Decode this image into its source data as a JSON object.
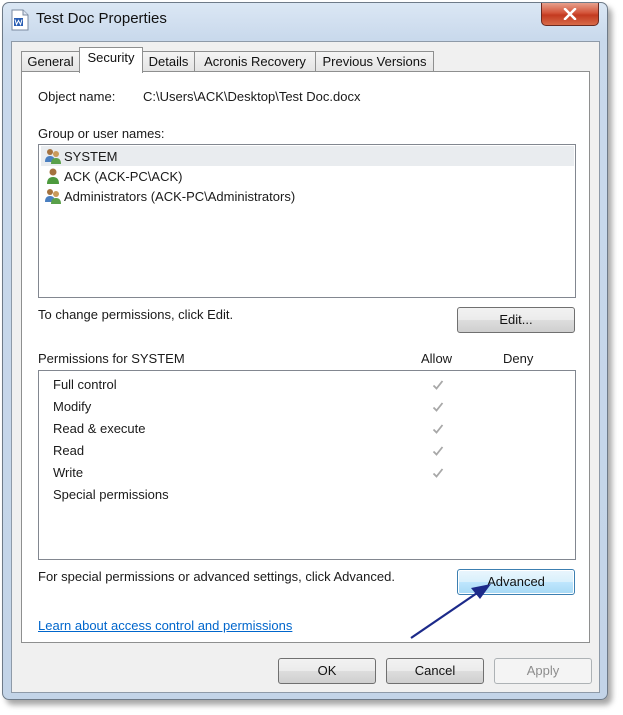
{
  "window": {
    "title": "Test Doc Properties"
  },
  "tabs": [
    {
      "label": "General"
    },
    {
      "label": "Security"
    },
    {
      "label": "Details"
    },
    {
      "label": "Acronis Recovery"
    },
    {
      "label": "Previous Versions"
    }
  ],
  "security": {
    "object_name_label": "Object name:",
    "object_name_value": "C:\\Users\\ACK\\Desktop\\Test Doc.docx",
    "group_label": "Group or user names:",
    "users": [
      {
        "name": "SYSTEM",
        "icon": "users-group-icon",
        "selected": true
      },
      {
        "name": "ACK (ACK-PC\\ACK)",
        "icon": "user-icon",
        "selected": false
      },
      {
        "name": "Administrators (ACK-PC\\Administrators)",
        "icon": "users-group-icon",
        "selected": false
      }
    ],
    "change_hint": "To change permissions, click Edit.",
    "edit_label": "Edit...",
    "permissions_for": "Permissions for SYSTEM",
    "allow_header": "Allow",
    "deny_header": "Deny",
    "permissions": [
      {
        "name": "Full control",
        "allow": true,
        "deny": false
      },
      {
        "name": "Modify",
        "allow": true,
        "deny": false
      },
      {
        "name": "Read & execute",
        "allow": true,
        "deny": false
      },
      {
        "name": "Read",
        "allow": true,
        "deny": false
      },
      {
        "name": "Write",
        "allow": true,
        "deny": false
      },
      {
        "name": "Special permissions",
        "allow": false,
        "deny": false
      }
    ],
    "advanced_hint": "For special permissions or advanced settings, click Advanced.",
    "advanced_label": "Advanced",
    "learn_link": "Learn about access control and permissions"
  },
  "footer": {
    "ok_label": "OK",
    "cancel_label": "Cancel",
    "apply_label": "Apply"
  },
  "colors": {
    "annotation_arrow": "#1c2a8a",
    "link": "#0066cc",
    "close_button": "#c8462c"
  }
}
